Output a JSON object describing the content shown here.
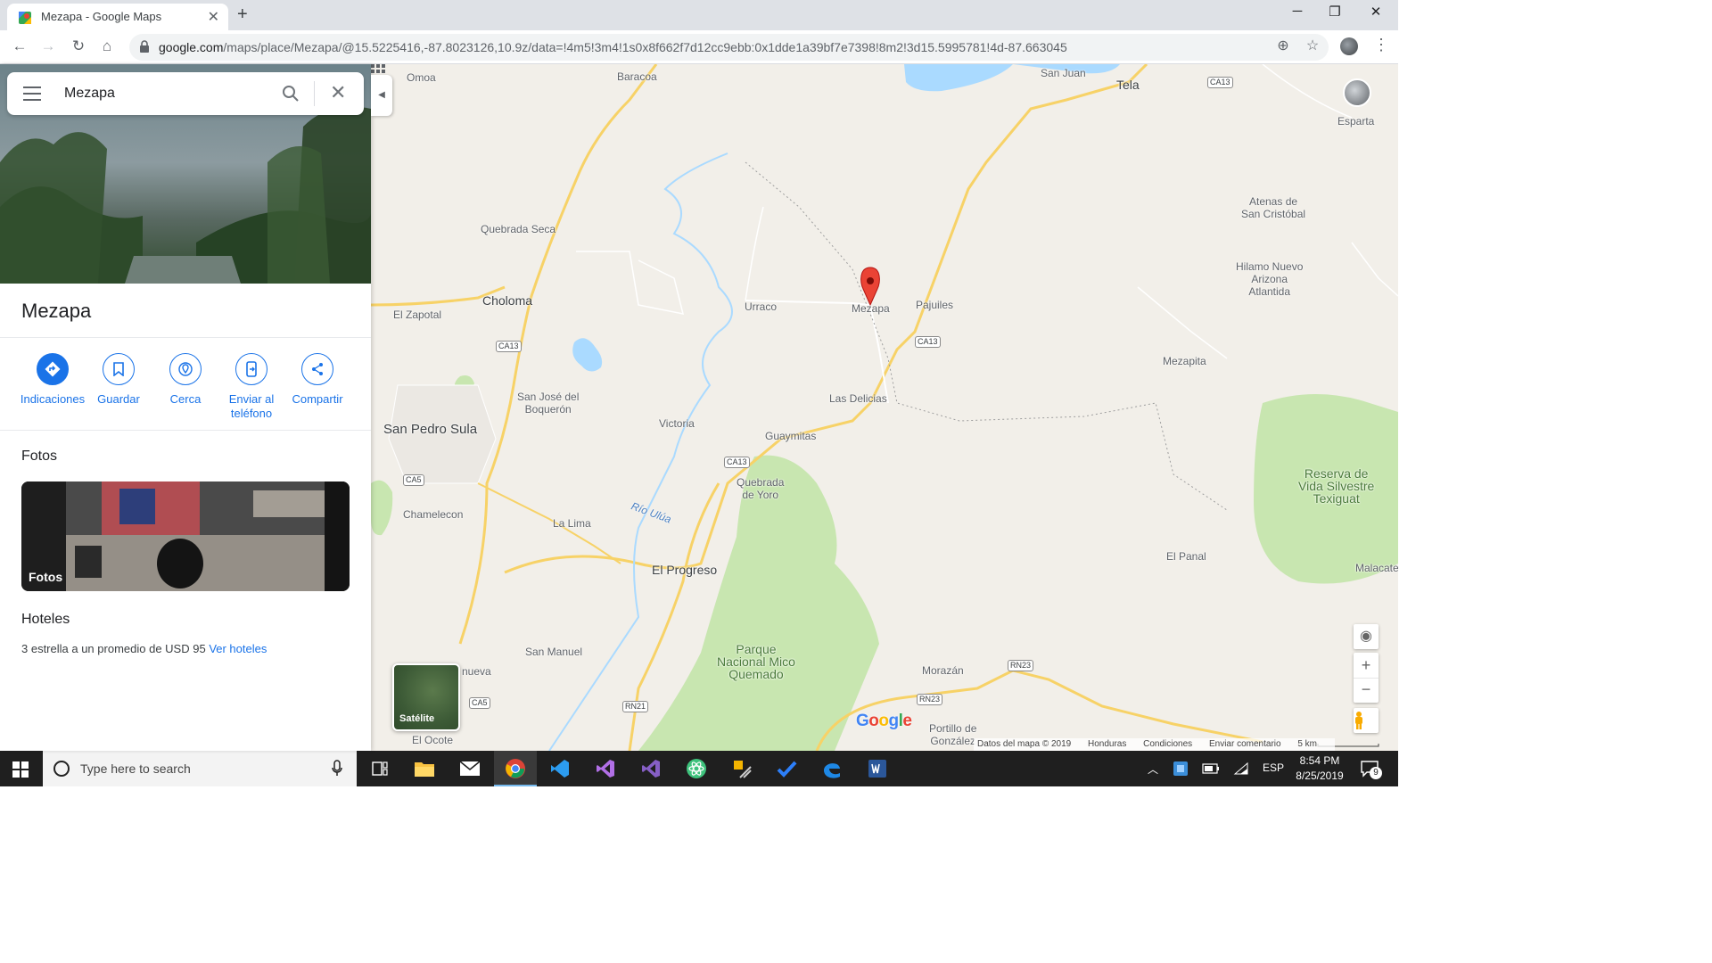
{
  "browser": {
    "tab_title": "Mezapa - Google Maps",
    "url_domain": "google.com",
    "url_path": "/maps/place/Mezapa/@15.5225416,-87.8023126,10.9z/data=!4m5!3m4!1s0x8f662f7d12cc9ebb:0x1dde1a39bf7e7398!8m2!3d15.5995781!4d-87.663045"
  },
  "search": {
    "value": "Mezapa"
  },
  "place": {
    "title": "Mezapa",
    "actions": [
      {
        "label": "Indicaciones"
      },
      {
        "label": "Guardar"
      },
      {
        "label": "Cerca"
      },
      {
        "label": "Enviar al teléfono"
      },
      {
        "label": "Compartir"
      }
    ],
    "photos_heading": "Fotos",
    "photos_card_label": "Fotos",
    "hotels_heading": "Hoteles",
    "hotels_text": "3 estrella a un promedio de USD 95",
    "hotels_link": "Ver hoteles"
  },
  "map": {
    "labels": {
      "omoa": "Omoa",
      "baracoa": "Baracoa",
      "san_juan": "San Juan",
      "tela": "Tela",
      "esparta": "Esparta",
      "atenas_1": "Atenas de",
      "atenas_2": "San Cristóbal",
      "hilamo_1": "Hilamo Nuevo",
      "hilamo_2": "Arizona",
      "hilamo_3": "Atlantida",
      "quebrada_seca": "Quebrada Seca",
      "choloma": "Choloma",
      "el_zapotal": "El Zapotal",
      "urraco": "Urraco",
      "mezapa": "Mezapa",
      "pajuiles": "Pajuiles",
      "mezapita": "Mezapita",
      "sj_boqueron_1": "San José del",
      "sj_boqueron_2": "Boquerón",
      "las_delicias": "Las Delicias",
      "victoria": "Victoria",
      "san_pedro_sula": "San Pedro Sula",
      "guaymitas": "Guaymitas",
      "quebrada_yoro_1": "Quebrada",
      "quebrada_yoro_2": "de Yoro",
      "reserva_1": "Reserva de",
      "reserva_2": "Vida Silvestre",
      "reserva_3": "Texiguat",
      "chamelecon": "Chamelecon",
      "la_lima": "La Lima",
      "rio_ulua": "Río Ulúa",
      "el_progreso": "El Progreso",
      "el_panal": "El Panal",
      "malacate": "Malacate",
      "parque_1": "Parque",
      "parque_2": "Nacional Mico",
      "parque_3": "Quemado",
      "san_manuel": "San Manuel",
      "nueva": "nueva",
      "morazan": "Morazán",
      "portillo_1": "Portillo de",
      "portillo_2": "González",
      "el_ocote": "El Ocote"
    },
    "shields": {
      "ca13_top": "CA13",
      "ca13_choloma": "CA13",
      "ca13_mezapa": "CA13",
      "ca13_guaymitas": "CA13",
      "ca5_sps": "CA5",
      "ca5_bottom": "CA5",
      "rn21": "RN21",
      "rn23_a": "RN23",
      "rn23_b": "RN23"
    },
    "satellite_label": "Satélite",
    "google_logo": "Google",
    "attribution": {
      "data": "Datos del mapa © 2019",
      "country": "Honduras",
      "terms": "Condiciones",
      "feedback": "Enviar comentario",
      "scale": "5 km"
    }
  },
  "taskbar": {
    "search_placeholder": "Type here to search",
    "lang": "ESP",
    "time": "8:54 PM",
    "date": "8/25/2019",
    "notifications": "9"
  },
  "colors": {
    "accent": "#1a73e8",
    "map_land": "#f2efe9",
    "map_park": "#c8e6b0",
    "map_water": "#aadaff",
    "highway": "#f7d267",
    "marker": "#ea4335"
  }
}
